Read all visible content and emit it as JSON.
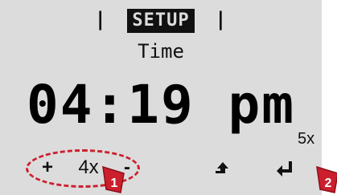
{
  "header": {
    "left_sep": "|",
    "title": "SETUP",
    "right_sep": "|"
  },
  "screen": {
    "subtitle": "Time",
    "time_value": "04:19 pm"
  },
  "buttons": {
    "plus": "+",
    "minus": "-",
    "up_icon": "up-arrow-icon",
    "enter_icon": "enter-icon"
  },
  "annotations": {
    "press_count_left": "4x",
    "press_count_right": "5x",
    "badge_1": "1",
    "badge_2": "2",
    "highlight_color": "#cc1f2d"
  },
  "colors": {
    "screen_bg": "#dcdcdc",
    "text": "#111111",
    "accent": "#cc1f2d"
  }
}
